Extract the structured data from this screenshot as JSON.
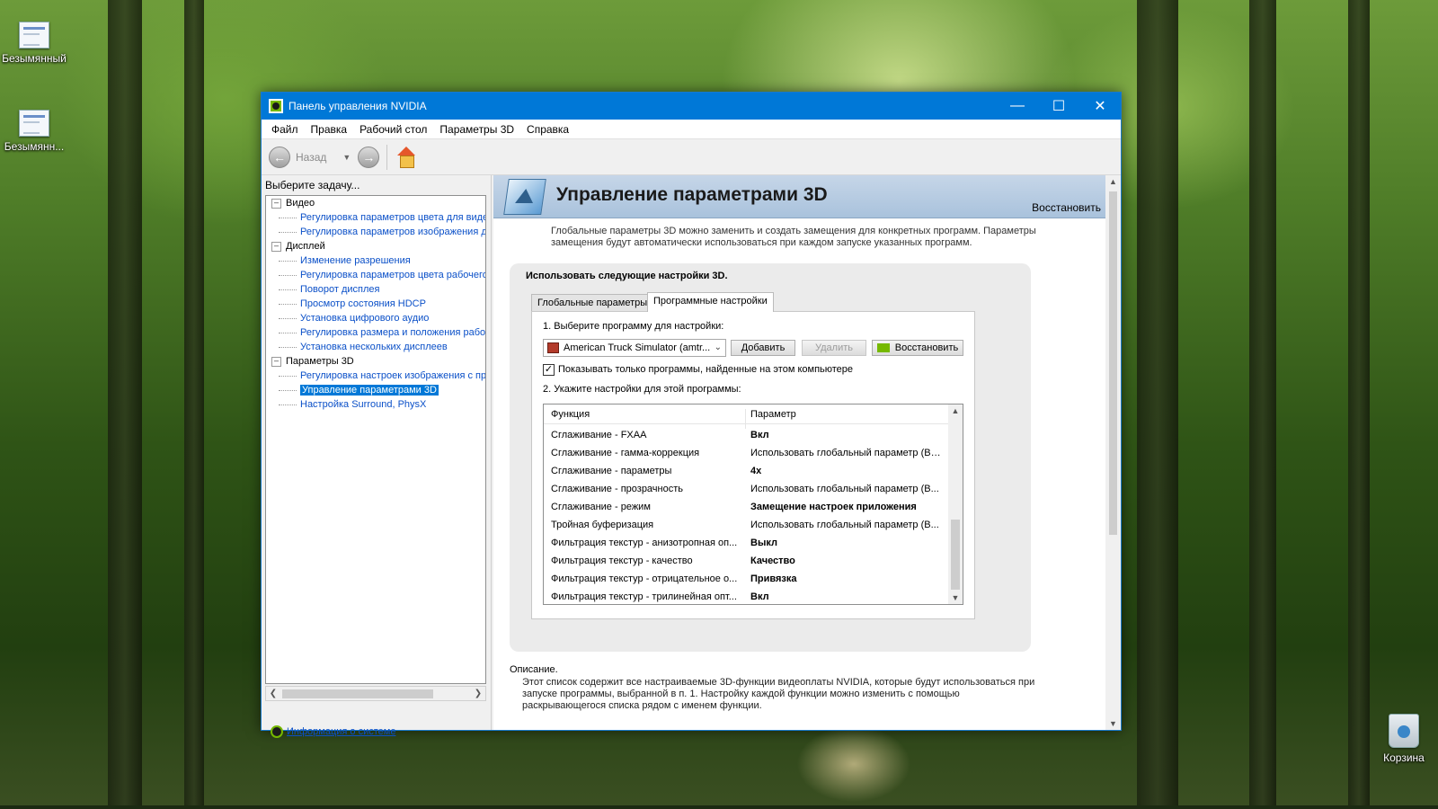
{
  "desktop": {
    "icons": [
      {
        "label": "Безымянный"
      },
      {
        "label": "Безымянн..."
      },
      {
        "label": "Корзина"
      }
    ]
  },
  "window": {
    "title": "Панель управления NVIDIA",
    "controls": {
      "minimize": "—",
      "maximize": "☐",
      "close": "✕"
    }
  },
  "menu": [
    "Файл",
    "Правка",
    "Рабочий стол",
    "Параметры 3D",
    "Справка"
  ],
  "toolbar": {
    "back_label": "Назад"
  },
  "left": {
    "task_label": "Выберите задачу...",
    "tree": [
      {
        "type": "cat",
        "label": "Видео"
      },
      {
        "type": "item",
        "label": "Регулировка параметров цвета для видео"
      },
      {
        "type": "item",
        "label": "Регулировка параметров изображения для видео"
      },
      {
        "type": "cat",
        "label": "Дисплей"
      },
      {
        "type": "item",
        "label": "Изменение разрешения"
      },
      {
        "type": "item",
        "label": "Регулировка параметров цвета рабочего стола"
      },
      {
        "type": "item",
        "label": "Поворот дисплея"
      },
      {
        "type": "item",
        "label": "Просмотр состояния HDCP"
      },
      {
        "type": "item",
        "label": "Установка цифрового аудио"
      },
      {
        "type": "item",
        "label": "Регулировка размера и положения рабочего стола"
      },
      {
        "type": "item",
        "label": "Установка нескольких дисплеев"
      },
      {
        "type": "cat",
        "label": "Параметры 3D"
      },
      {
        "type": "item",
        "label": "Регулировка настроек изображения с просмотром"
      },
      {
        "type": "item",
        "label": "Управление параметрами 3D",
        "selected": true
      },
      {
        "type": "item",
        "label": "Настройка Surround, PhysX"
      }
    ],
    "sysinfo_link": "Информация о системе"
  },
  "main": {
    "title": "Управление параметрами 3D",
    "restore_link": "Восстановить",
    "intro": "Глобальные параметры 3D можно заменить и создать замещения для конкретных программ. Параметры замещения будут автоматически использоваться при каждом запуске указанных программ.",
    "section_title": "Использовать следующие настройки 3D.",
    "tabs": [
      {
        "label": "Глобальные параметры",
        "active": false
      },
      {
        "label": "Программные настройки",
        "active": true
      }
    ],
    "step1": "1. Выберите программу для настройки:",
    "program_selected": "American Truck Simulator (amtr...",
    "add_button": "Добавить",
    "remove_button": "Удалить",
    "restore_button": "Восстановить",
    "show_only_found": "Показывать только программы, найденные на этом компьютере",
    "show_only_found_checked": true,
    "step2": "2. Укажите настройки для этой программы:",
    "grid": {
      "col_function": "Функция",
      "col_param": "Параметр",
      "rows": [
        {
          "f": "Сглаживание - FXAA",
          "p": "Вкл",
          "bold": true
        },
        {
          "f": "Сглаживание - гамма-коррекция",
          "p": "Использовать глобальный параметр (Вкл)",
          "bold": false
        },
        {
          "f": "Сглаживание - параметры",
          "p": "4x",
          "bold": true
        },
        {
          "f": "Сглаживание - прозрачность",
          "p": "Использовать глобальный параметр (В...",
          "bold": false
        },
        {
          "f": "Сглаживание - режим",
          "p": "Замещение настроек приложения",
          "bold": true
        },
        {
          "f": "Тройная буферизация",
          "p": "Использовать глобальный параметр (В...",
          "bold": false
        },
        {
          "f": "Фильтрация текстур - анизотропная оп...",
          "p": "Выкл",
          "bold": true
        },
        {
          "f": "Фильтрация текстур - качество",
          "p": "Качество",
          "bold": true
        },
        {
          "f": "Фильтрация текстур - отрицательное о...",
          "p": "Привязка",
          "bold": true
        },
        {
          "f": "Фильтрация текстур - трилинейная опт...",
          "p": "Вкл",
          "bold": true
        }
      ]
    },
    "description_title": "Описание.",
    "description": "Этот список содержит все настраиваемые 3D-функции видеоплаты NVIDIA, которые будут использоваться при запуске программы, выбранной в п. 1. Настройку каждой функции можно изменить с помощью раскрывающегося списка рядом с именем функции."
  }
}
